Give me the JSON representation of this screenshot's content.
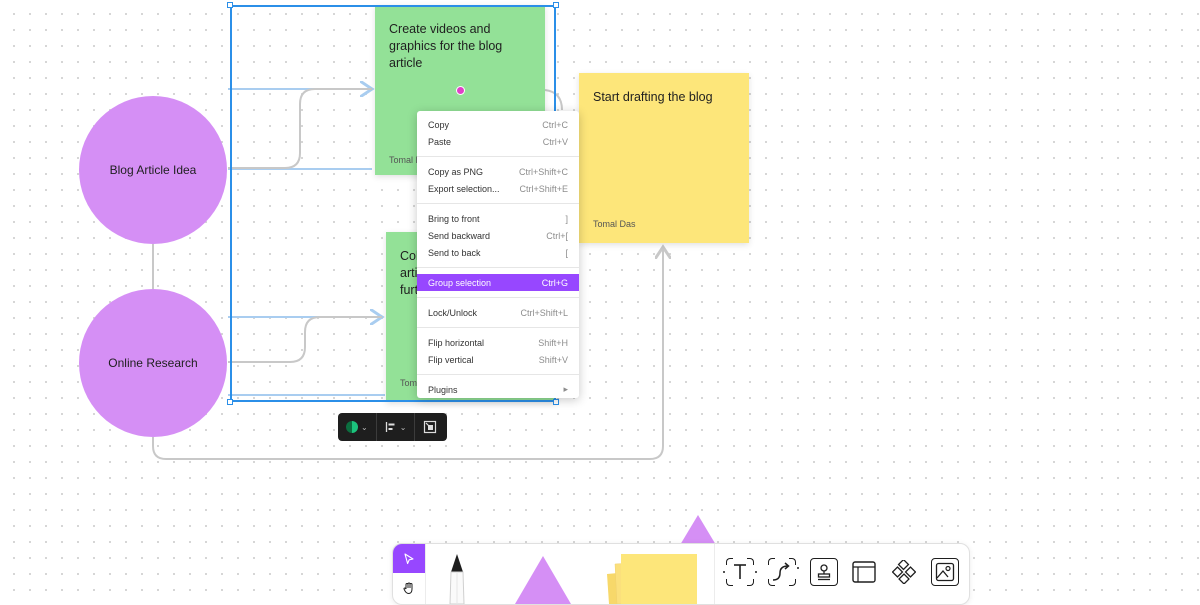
{
  "canvas": {
    "circles": [
      {
        "label": "Blog Article Idea",
        "color": "#d58ff5"
      },
      {
        "label": "Online Research",
        "color": "#d58ff5"
      }
    ],
    "stickies": [
      {
        "text": "Create videos and graphics for the blog article",
        "author": "Tomal D",
        "color": "#93e197"
      },
      {
        "text": "Col arti furt",
        "author": "Tom",
        "color": "#93e197"
      },
      {
        "text": "Start drafting the blog",
        "author": "Tomal Das",
        "color": "#fde67a"
      }
    ],
    "selection_color": "#2b8fe8"
  },
  "context_menu": {
    "groups": [
      [
        {
          "label": "Copy",
          "shortcut": "Ctrl+C"
        },
        {
          "label": "Paste",
          "shortcut": "Ctrl+V"
        }
      ],
      [
        {
          "label": "Copy as PNG",
          "shortcut": "Ctrl+Shift+C"
        },
        {
          "label": "Export selection...",
          "shortcut": "Ctrl+Shift+E"
        }
      ],
      [
        {
          "label": "Bring to front",
          "shortcut": "]"
        },
        {
          "label": "Send backward",
          "shortcut": "Ctrl+["
        },
        {
          "label": "Send to back",
          "shortcut": "["
        }
      ],
      [
        {
          "label": "Group selection",
          "shortcut": "Ctrl+G",
          "active": true
        }
      ],
      [
        {
          "label": "Lock/Unlock",
          "shortcut": "Ctrl+Shift+L"
        }
      ],
      [
        {
          "label": "Flip horizontal",
          "shortcut": "Shift+H"
        },
        {
          "label": "Flip vertical",
          "shortcut": "Shift+V"
        }
      ],
      [
        {
          "label": "Plugins",
          "shortcut": "▸"
        }
      ]
    ],
    "active_color": "#9747ff"
  },
  "selection_toolbar": {
    "items": [
      {
        "icon": "color-picker-icon"
      },
      {
        "icon": "align-left-icon"
      },
      {
        "icon": "resize-to-fit-icon"
      }
    ]
  },
  "toolbar": {
    "accent": "#9747ff",
    "modes": [
      {
        "icon": "cursor-icon",
        "active": true
      },
      {
        "icon": "hand-icon",
        "active": false
      }
    ],
    "tools": [
      {
        "icon": "pencil-icon"
      },
      {
        "icon": "shapes-icon"
      },
      {
        "icon": "sticky-notes-icon"
      },
      {
        "icon": "text-icon"
      },
      {
        "icon": "connector-icon"
      },
      {
        "icon": "stamp-icon"
      },
      {
        "icon": "section-icon"
      },
      {
        "icon": "widgets-icon"
      },
      {
        "icon": "image-icon"
      }
    ]
  }
}
